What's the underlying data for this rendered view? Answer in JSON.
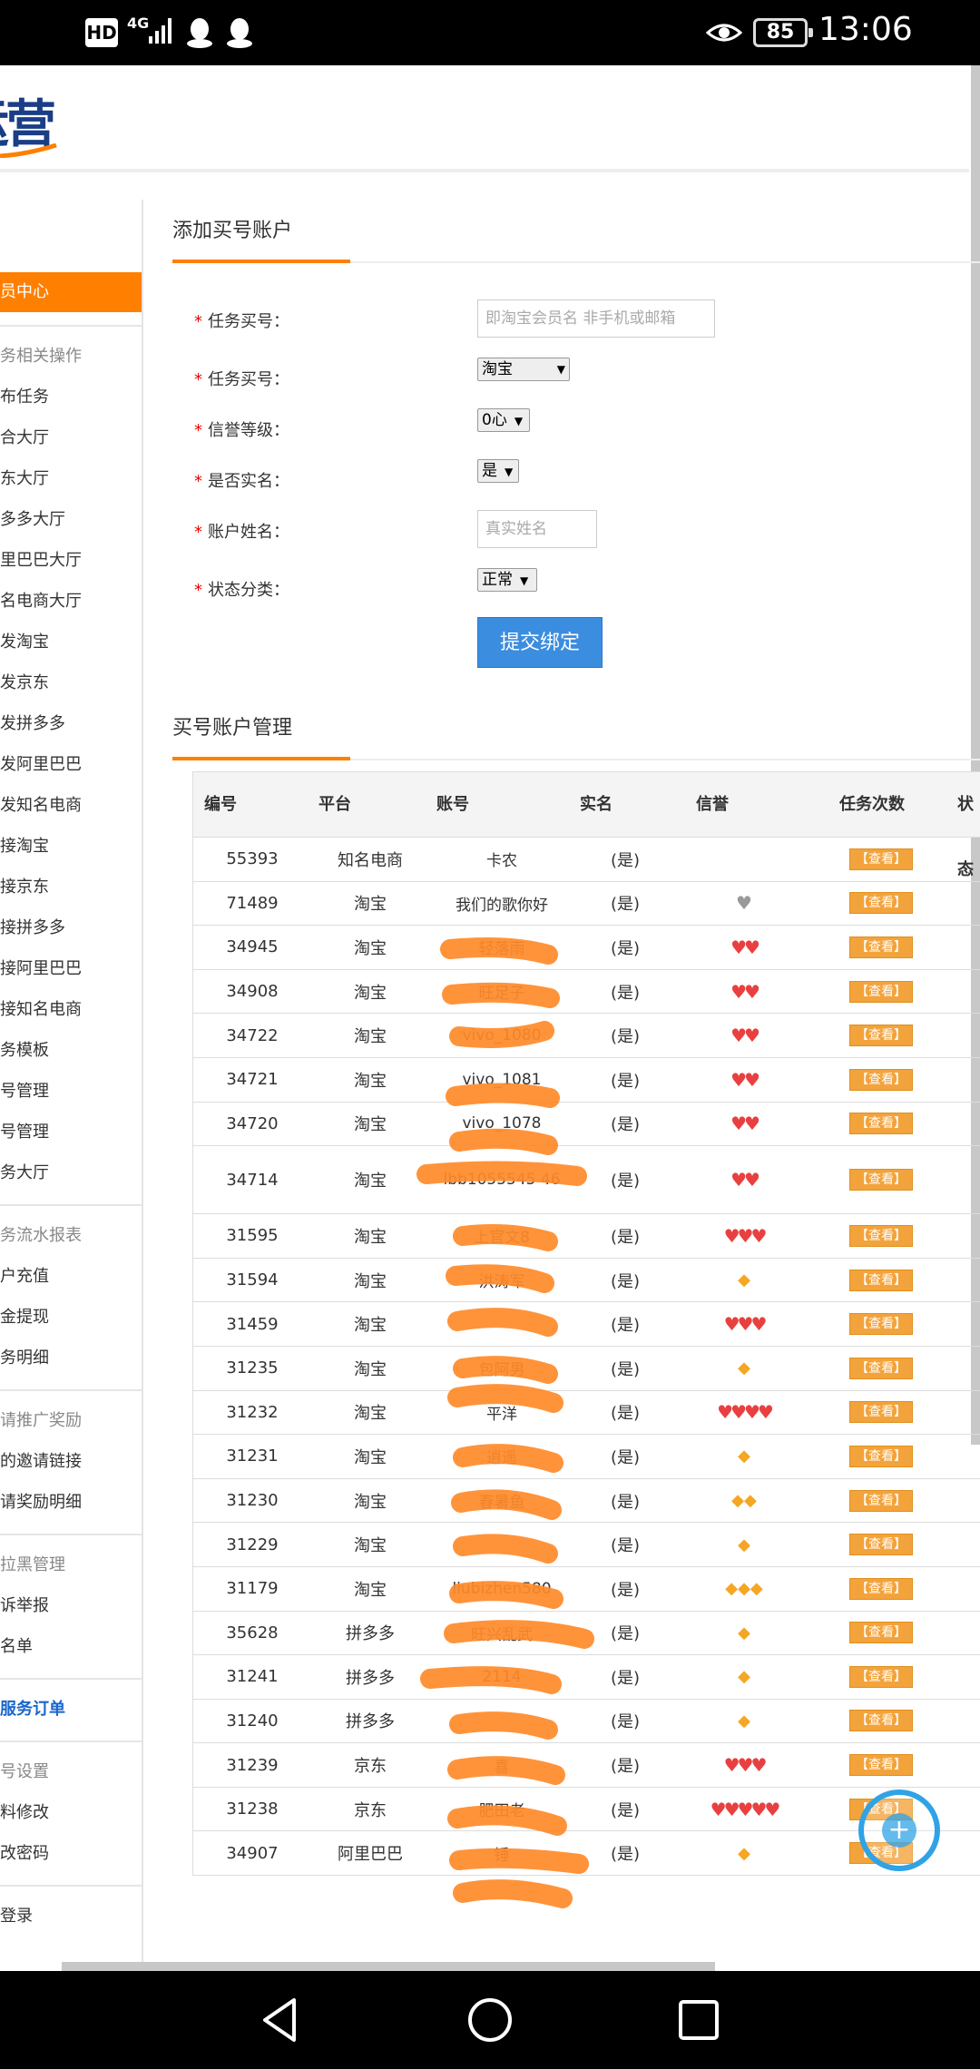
{
  "status_bar": {
    "hd": "HD",
    "network": "4G",
    "battery": "85",
    "time": "13:06"
  },
  "logo": {
    "text": "运营"
  },
  "sidebar": {
    "active": "员中心",
    "groups": [
      {
        "heading": "务相关操作",
        "items": [
          "布任务",
          "合大厅",
          "东大厅",
          "多多大厅",
          "里巴巴大厅",
          "名电商大厅",
          "发淘宝",
          "发京东",
          "发拼多多",
          "发阿里巴巴",
          "发知名电商",
          "接淘宝",
          "接京东",
          "接拼多多",
          "接阿里巴巴",
          "接知名电商",
          "务模板",
          "号管理",
          "号管理",
          "务大厅"
        ]
      },
      {
        "heading": "务流水报表",
        "items": [
          "户充值",
          "金提现",
          "务明细"
        ]
      },
      {
        "heading": "请推广奖励",
        "items": [
          "的邀请链接",
          "请奖励明细"
        ]
      },
      {
        "heading": "拉黑管理",
        "items": [
          "诉举报",
          "名单"
        ]
      },
      {
        "heading_blue": "服务订单"
      },
      {
        "heading": "号设置",
        "items": [
          "料修改",
          "改密码"
        ]
      },
      {
        "item": "登录"
      }
    ]
  },
  "form": {
    "title": "添加买号账户",
    "fields": {
      "task_account_label": "任务买号：",
      "task_account_placeholder": "即淘宝会员名 非手机或邮箱",
      "platform_label": "任务买号：",
      "platform_value": "淘宝",
      "credit_label": "信誉等级：",
      "credit_value": "0心",
      "realname_label": "是否实名：",
      "realname_value": "是",
      "account_name_label": "账户姓名：",
      "account_name_placeholder": "真实姓名",
      "status_label": "状态分类：",
      "status_value": "正常"
    },
    "submit": "提交绑定"
  },
  "table": {
    "title": "买号账户管理",
    "headers": [
      "编号",
      "平台",
      "账号",
      "实名",
      "信誉",
      "任务次数",
      "状态"
    ],
    "view_label": "【查看】",
    "rows": [
      {
        "id": "55393",
        "platform": "知名电商",
        "account": "卡农",
        "real": "(是)",
        "credit": "",
        "credit_type": "none"
      },
      {
        "id": "71489",
        "platform": "淘宝",
        "account": "我们的歌你好",
        "real": "(是)",
        "credit": "♥",
        "credit_type": "grey"
      },
      {
        "id": "34945",
        "platform": "淘宝",
        "account": "轻落雨",
        "real": "(是)",
        "credit": "♥♥",
        "credit_type": "heart"
      },
      {
        "id": "34908",
        "platform": "淘宝",
        "account": "旺足子",
        "real": "(是)",
        "credit": "♥♥",
        "credit_type": "heart"
      },
      {
        "id": "34722",
        "platform": "淘宝",
        "account": "vivo_1080",
        "real": "(是)",
        "credit": "♥♥",
        "credit_type": "heart"
      },
      {
        "id": "34721",
        "platform": "淘宝",
        "account": "vivo_1081",
        "real": "(是)",
        "credit": "♥♥",
        "credit_type": "heart"
      },
      {
        "id": "34720",
        "platform": "淘宝",
        "account": "vivo_1078",
        "real": "(是)",
        "credit": "♥♥",
        "credit_type": "heart"
      },
      {
        "id": "34714",
        "platform": "淘宝",
        "account": "lbb1055545 46",
        "real": "(是)",
        "credit": "♥♥",
        "credit_type": "heart",
        "tall": true
      },
      {
        "id": "31595",
        "platform": "淘宝",
        "account": "上官文8",
        "real": "(是)",
        "credit": "♥♥♥",
        "credit_type": "heart"
      },
      {
        "id": "31594",
        "platform": "淘宝",
        "account": "洪涛军",
        "real": "(是)",
        "credit": "◆",
        "credit_type": "diamond"
      },
      {
        "id": "31459",
        "platform": "淘宝",
        "account": "",
        "real": "(是)",
        "credit": "♥♥♥",
        "credit_type": "heart"
      },
      {
        "id": "31235",
        "platform": "淘宝",
        "account": "包阿男",
        "real": "(是)",
        "credit": "◆",
        "credit_type": "diamond"
      },
      {
        "id": "31232",
        "platform": "淘宝",
        "account": "平洋",
        "real": "(是)",
        "credit": "♥♥♥♥",
        "credit_type": "heart"
      },
      {
        "id": "31231",
        "platform": "淘宝",
        "account": "逍遥",
        "real": "(是)",
        "credit": "◆",
        "credit_type": "diamond"
      },
      {
        "id": "31230",
        "platform": "淘宝",
        "account": "春暑鱼",
        "real": "(是)",
        "credit": "◆◆",
        "credit_type": "diamond"
      },
      {
        "id": "31229",
        "platform": "淘宝",
        "account": "",
        "real": "(是)",
        "credit": "◆",
        "credit_type": "diamond"
      },
      {
        "id": "31179",
        "platform": "淘宝",
        "account": "liubizhen580",
        "real": "(是)",
        "credit": "◆◆◆",
        "credit_type": "diamond"
      },
      {
        "id": "35628",
        "platform": "拼多多",
        "account": "旺兴乱武",
        "real": "(是)",
        "credit": "◆",
        "credit_type": "diamond"
      },
      {
        "id": "31241",
        "platform": "拼多多",
        "account": "2114",
        "real": "(是)",
        "credit": "◆",
        "credit_type": "diamond"
      },
      {
        "id": "31240",
        "platform": "拼多多",
        "account": "",
        "real": "(是)",
        "credit": "◆",
        "credit_type": "diamond"
      },
      {
        "id": "31239",
        "platform": "京东",
        "account": "喜",
        "real": "(是)",
        "credit": "♥♥♥",
        "credit_type": "heart"
      },
      {
        "id": "31238",
        "platform": "京东",
        "account": "肥田老",
        "real": "(是)",
        "credit": "♥♥♥♥♥",
        "credit_type": "heart"
      },
      {
        "id": "34907",
        "platform": "阿里巴巴",
        "account": "锤",
        "real": "(是)",
        "credit": "◆",
        "credit_type": "diamond"
      }
    ]
  },
  "colors": {
    "accent": "#ff7f00",
    "submit": "#3b8de0",
    "view_button": "#f3a33b",
    "scribble": "#ff8a2a"
  },
  "icons": {
    "fab": "plus-icon",
    "nav_back": "back-triangle-icon",
    "nav_home": "home-circle-icon",
    "nav_recent": "recent-square-icon"
  }
}
